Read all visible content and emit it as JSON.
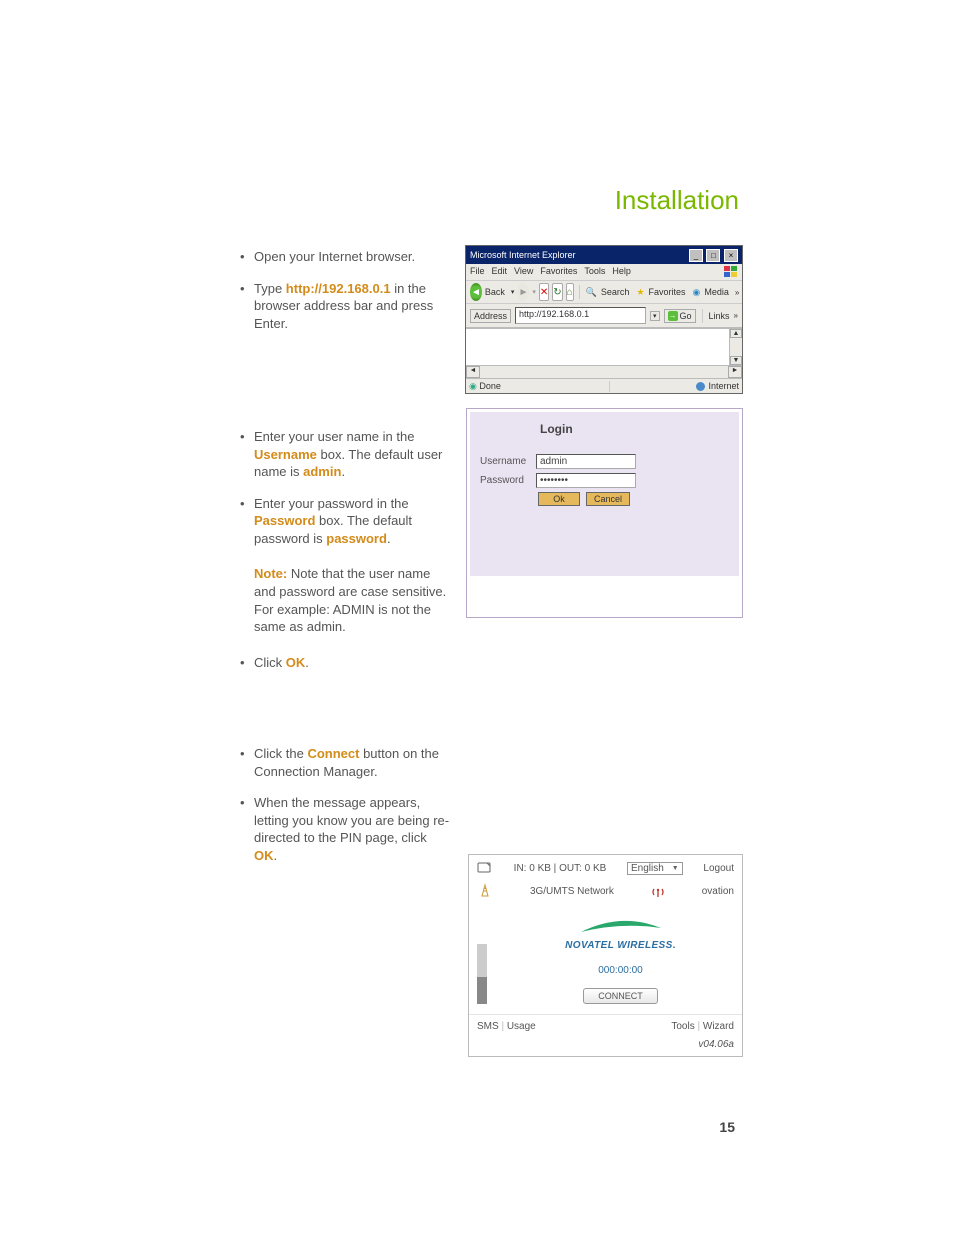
{
  "header": "Installation",
  "page_number": "15",
  "instructions": {
    "s1a": "Open your Internet browser.",
    "s1b_pre": "Type ",
    "s1b_url": "http://192.168.0.1",
    "s1b_post": " in the browser address bar and press Enter.",
    "s2a_pre": "Enter your user name in the ",
    "s2a_kw": "Username",
    "s2a_mid": " box. The default user name is ",
    "s2a_val": "admin",
    "s2a_post": ".",
    "s2b_pre": "Enter your password in the ",
    "s2b_kw": "Password",
    "s2b_mid": " box. The default password is ",
    "s2b_val": "password",
    "s2b_post": ".",
    "note_label": "Note:",
    "note_text": " Note that the user name and password are case sensitive. For example: ADMIN is not the same as admin.",
    "s2c_pre": "Click ",
    "s2c_kw": "OK",
    "s2c_post": ".",
    "s3a_pre": "Click the ",
    "s3a_kw": "Connect",
    "s3a_post": " button on the Connection Manager.",
    "s3b_pre": "When the message appears, letting you know you are being re-directed to the PIN page, click ",
    "s3b_kw": "OK",
    "s3b_post": "."
  },
  "browser": {
    "title": "Microsoft Internet Explorer",
    "menu": {
      "file": "File",
      "edit": "Edit",
      "view": "View",
      "favorites": "Favorites",
      "tools": "Tools",
      "help": "Help"
    },
    "toolbar": {
      "back": "Back",
      "search": "Search",
      "favorites": "Favorites",
      "media": "Media"
    },
    "address_label": "Address",
    "address_value": "http://192.168.0.1",
    "go": "Go",
    "links": "Links",
    "status_done": "Done",
    "status_zone": "Internet",
    "chevrons": "»"
  },
  "login": {
    "title": "Login",
    "username_label": "Username",
    "username_value": "admin",
    "password_label": "Password",
    "password_value": "••••••••",
    "ok": "Ok",
    "cancel": "Cancel"
  },
  "cm": {
    "stats": "IN: 0 KB |  OUT: 0 KB",
    "lang": "English",
    "logout": "Logout",
    "network": "3G/UMTS Network",
    "brand_model": "ovation",
    "brand": "NOVATEL WIRELESS",
    "brand_dot": ".",
    "timer": "000:00:00",
    "connect": "CONNECT",
    "sms": "SMS",
    "usage": "Usage",
    "tools": "Tools",
    "wizard": "Wizard",
    "footer": "v04.06a",
    "sep": " | "
  }
}
